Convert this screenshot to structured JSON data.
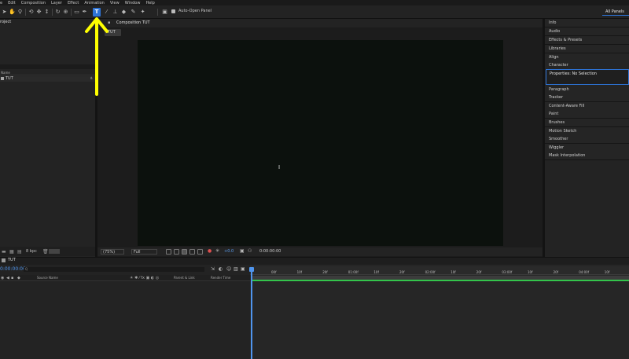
{
  "menu": [
    "e",
    "Edit",
    "Composition",
    "Layer",
    "Effect",
    "Animation",
    "View",
    "Window",
    "Help"
  ],
  "toolbar": {
    "auto_open_label": "Auto-Open Panel",
    "all_panels": "All Panels",
    "type_tool_glyph": "T"
  },
  "project": {
    "tab": "roject",
    "col_name": "Name",
    "item_label": "TUT",
    "bpc": "8 bpc"
  },
  "composition": {
    "tab": "Composition TUT",
    "sub_tab": "TUT",
    "zoom": "(75%)",
    "resolution": "Full",
    "exposure": "+0.0",
    "timecode": "0:00:00:00"
  },
  "right_panels": [
    "Info",
    "Audio",
    "Effects & Presets",
    "Libraries",
    "Align",
    "Character",
    "Paragraph",
    "Tracker",
    "Content-Aware Fill",
    "Paint",
    "Brushes",
    "Motion Sketch",
    "Smoother",
    "Wiggler",
    "Mask Interpolation"
  ],
  "properties_panel": "Properties: No Selection",
  "timeline": {
    "tab": "TUT",
    "time": "0:00:00:00",
    "search_placeholder": "Q",
    "col_source": "Source Name",
    "col_parent": "Parent & Link",
    "col_render": "Render Time",
    "ruler_ticks": [
      "00f",
      "10f",
      "20f",
      "01:00f",
      "10f",
      "20f",
      "02:00f",
      "10f",
      "20f",
      "03:00f",
      "10f",
      "20f",
      "04:00f",
      "10f",
      "20f"
    ]
  },
  "colors": {
    "accent": "#2d73d6",
    "annotation_arrow": "#ffff00",
    "timecode": "#4f95ee",
    "work_area_bar": "#33c44b"
  }
}
